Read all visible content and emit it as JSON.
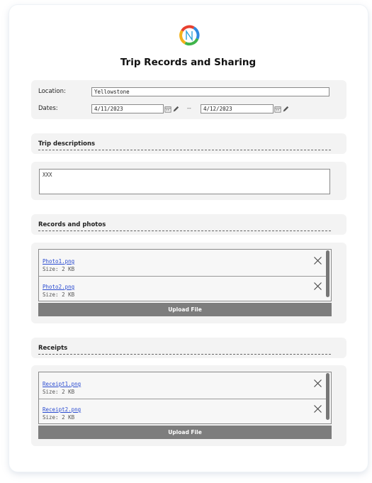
{
  "page": {
    "title": "Trip Records and Sharing"
  },
  "form": {
    "location_label": "Location:",
    "location_value": "Yellowstone",
    "dates_label": "Dates:",
    "date_start": "4/11/2023",
    "date_separator": "--",
    "date_end": "4/12/2023"
  },
  "description": {
    "title": "Trip descriptions",
    "text": "XXX"
  },
  "records": {
    "title": "Records and photos",
    "files": [
      {
        "name": "Photo1.png",
        "size": "Size: 2 KB"
      },
      {
        "name": "Photo2.png",
        "size": "Size: 2 KB"
      }
    ],
    "upload_label": "Upload File"
  },
  "receipts": {
    "title": "Receipts",
    "files": [
      {
        "name": "Receipt1.png",
        "size": "Size: 2 KB"
      },
      {
        "name": "Receipt2.png",
        "size": "Size: 2 KB"
      }
    ],
    "upload_label": "Upload File"
  },
  "icons": {
    "logo": "logo-icon",
    "calendar": "calendar-icon",
    "edit": "pencil-icon",
    "remove": "close-icon"
  },
  "colors": {
    "link": "#2a4bd0",
    "upload_button": "#7d7d7d",
    "panel": "#f3f3f3"
  }
}
